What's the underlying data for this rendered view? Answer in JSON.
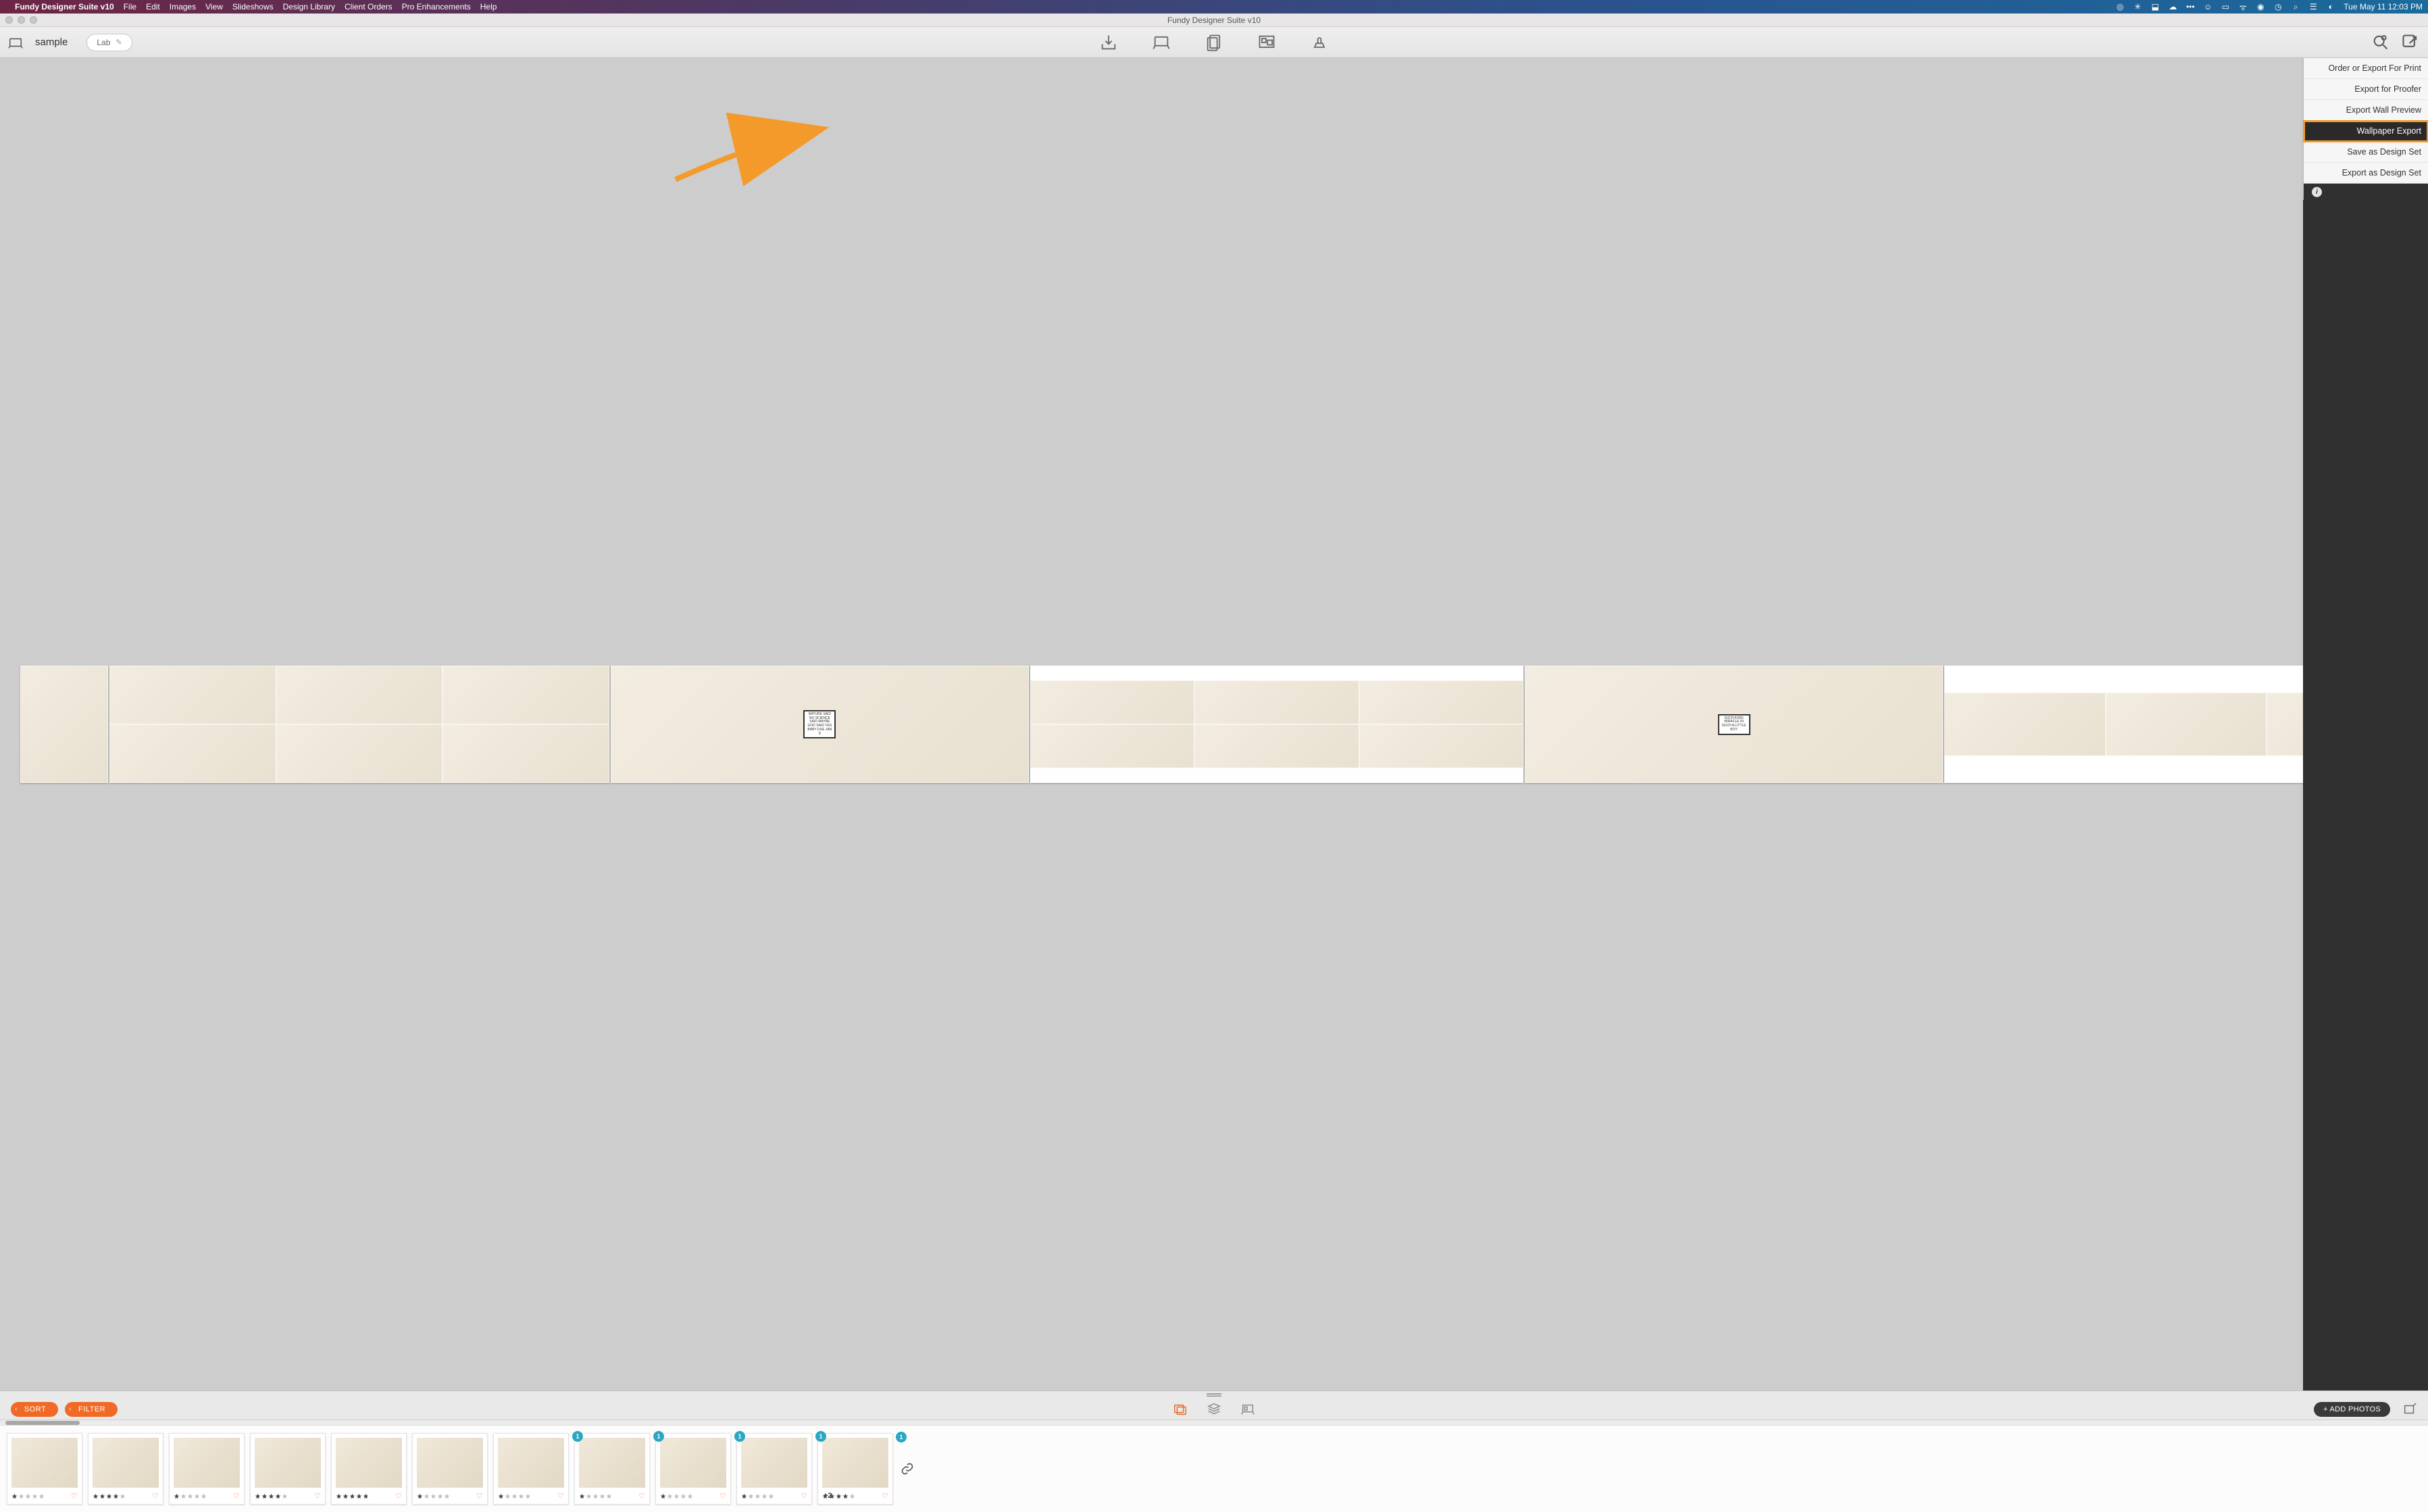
{
  "menubar": {
    "app_name": "Fundy Designer Suite v10",
    "items": [
      "File",
      "Edit",
      "Images",
      "View",
      "Slideshows",
      "Design Library",
      "Client Orders",
      "Pro Enhancements",
      "Help"
    ],
    "date_time": "Tue May 11  12:03 PM"
  },
  "window": {
    "title": "Fundy Designer Suite v10"
  },
  "toolbar": {
    "project_name": "sample",
    "lab_label": "Lab"
  },
  "export_menu": {
    "items": [
      "Order or Export For Print",
      "Export for Proofer",
      "Export Wall Preview",
      "Wallpaper Export",
      "Save as Design Set",
      "Export as Design Set"
    ],
    "highlighted_index": 3
  },
  "spread_captions": {
    "sign1": "NATURE SAID NO SCIENCE SAID MAYBE GOD SAID YES BABY DUE JAN 8",
    "sign2": "SUCH A BIG MIRACLE IN SUCH A LITTLE BOY"
  },
  "controls": {
    "sort_label": "SORT",
    "filter_label": "FILTER",
    "add_photos_label": "+ ADD PHOTOS"
  },
  "thumbnails": [
    {
      "rating": 1,
      "badge": null,
      "extra": null
    },
    {
      "rating": 4,
      "badge": null,
      "extra": null
    },
    {
      "rating": 1,
      "badge": null,
      "extra": null
    },
    {
      "rating": 4,
      "badge": null,
      "extra": null
    },
    {
      "rating": 5,
      "badge": null,
      "extra": null
    },
    {
      "rating": 1,
      "badge": null,
      "extra": null
    },
    {
      "rating": 1,
      "badge": null,
      "extra": null
    },
    {
      "rating": 1,
      "badge": "1",
      "extra": null
    },
    {
      "rating": 1,
      "badge": "1",
      "extra": null
    },
    {
      "rating": 1,
      "badge": "1",
      "extra": null
    },
    {
      "rating": 4,
      "badge": "1",
      "extra": "+2"
    }
  ],
  "thumbnails_trailing_badge": "1"
}
